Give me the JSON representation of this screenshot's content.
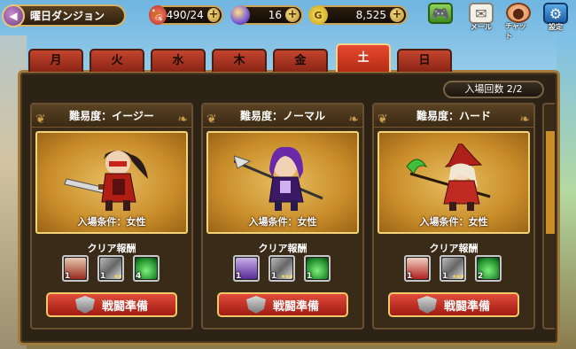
{
  "header": {
    "title": "曜日ダンジョン",
    "stamina": "490/24",
    "orbs": "16",
    "gold": "8,525",
    "gold_icon": "G",
    "icons": [
      {
        "name": "game-controller-icon",
        "label": ""
      },
      {
        "name": "mail-icon",
        "label": "メール"
      },
      {
        "name": "chat-icon",
        "label": "チャット"
      },
      {
        "name": "settings-icon",
        "label": "設定"
      }
    ]
  },
  "tabs": [
    {
      "label": "月",
      "active": false
    },
    {
      "label": "火",
      "active": false
    },
    {
      "label": "水",
      "active": false
    },
    {
      "label": "木",
      "active": false
    },
    {
      "label": "金",
      "active": false
    },
    {
      "label": "土",
      "active": true
    },
    {
      "label": "日",
      "active": false
    }
  ],
  "panel": {
    "entry_count": "入場回数 2/2",
    "reward_label": "クリア報酬",
    "prepare_label": "戦闘準備",
    "cards": [
      {
        "difficulty": "難易度：イージー",
        "condition": "入場条件：女性",
        "rewards": [
          {
            "type": "character",
            "count": "1"
          },
          {
            "type": "weapon",
            "count": "1",
            "stars": "★★"
          },
          {
            "type": "potion",
            "count": "4"
          }
        ]
      },
      {
        "difficulty": "難易度：ノーマル",
        "condition": "入場条件：女性",
        "rewards": [
          {
            "type": "character",
            "count": "1"
          },
          {
            "type": "weapon",
            "count": "1",
            "stars": "★★★"
          },
          {
            "type": "potion",
            "count": "1"
          }
        ]
      },
      {
        "difficulty": "難易度：ハード",
        "condition": "入場条件：女性",
        "rewards": [
          {
            "type": "character",
            "count": "1"
          },
          {
            "type": "weapon",
            "count": "1",
            "stars": "★★★"
          },
          {
            "type": "potion",
            "count": "2"
          }
        ]
      }
    ]
  },
  "colors": {
    "tab_active": "#e84a2e",
    "tab_inactive": "#8a2416",
    "button": "#c0281a",
    "portrait_bg": "#e8be62",
    "frame_gold": "#a27a3c"
  }
}
